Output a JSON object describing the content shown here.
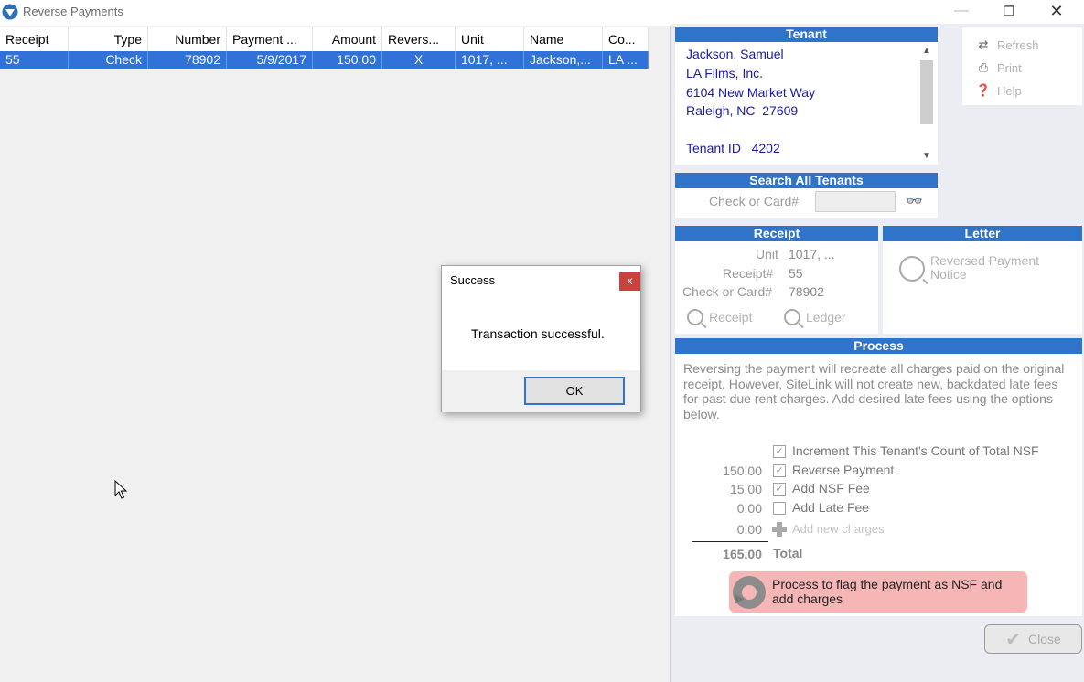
{
  "window": {
    "title": "Reverse Payments"
  },
  "grid": {
    "columns": [
      "Receipt",
      "Type",
      "Number",
      "Payment ...",
      "Amount",
      "Revers...",
      "Unit",
      "Name",
      "Co..."
    ],
    "rows": [
      [
        "55",
        "Check",
        "78902",
        "5/9/2017",
        "150.00",
        "X",
        "1017, ...",
        "Jackson,...",
        "LA ..."
      ]
    ]
  },
  "tenant": {
    "heading": "Tenant",
    "name": "Jackson, Samuel",
    "company": "LA Films, Inc.",
    "address1": "6104 New Market Way",
    "address2": "Raleigh, NC  27609",
    "tenant_id_label": "Tenant ID",
    "tenant_id": "4202"
  },
  "toolbar": {
    "refresh": "Refresh",
    "print": "Print",
    "help": "Help"
  },
  "search": {
    "heading": "Search All Tenants",
    "label": "Check or Card#",
    "value": ""
  },
  "receipt": {
    "heading": "Receipt",
    "unit_label": "Unit",
    "unit": "1017, ...",
    "receipt_label": "Receipt#",
    "receipt": "55",
    "check_label": "Check or Card#",
    "check": "78902",
    "receipt_btn": "Receipt",
    "ledger_btn": "Ledger"
  },
  "letter": {
    "heading": "Letter",
    "item": "Reversed Payment Notice"
  },
  "process": {
    "heading": "Process",
    "description": "Reversing the payment will recreate all charges paid on the original receipt.  However, SiteLink will not create new, backdated late fees for past due rent charges.  Add desired late fees using the options below.",
    "items": [
      {
        "amount": "",
        "checked": true,
        "label": "Increment This Tenant's Count of Total NSF"
      },
      {
        "amount": "150.00",
        "checked": true,
        "label": "Reverse Payment"
      },
      {
        "amount": "15.00",
        "checked": true,
        "label": "Add NSF Fee"
      },
      {
        "amount": "0.00",
        "checked": false,
        "label": "Add Late Fee"
      }
    ],
    "new_charges": {
      "amount": "0.00",
      "label": "Add new charges"
    },
    "total": {
      "amount": "165.00",
      "label": "Total"
    },
    "button": "Process to flag the payment as NSF and add charges"
  },
  "close_label": "Close",
  "dialog": {
    "title": "Success",
    "message": "Transaction successful.",
    "ok": "OK",
    "close": "x"
  },
  "colors": {
    "header_blue": "#2f74c8",
    "selection_blue": "#3072d8",
    "process_btn": "#f6b6b6"
  }
}
